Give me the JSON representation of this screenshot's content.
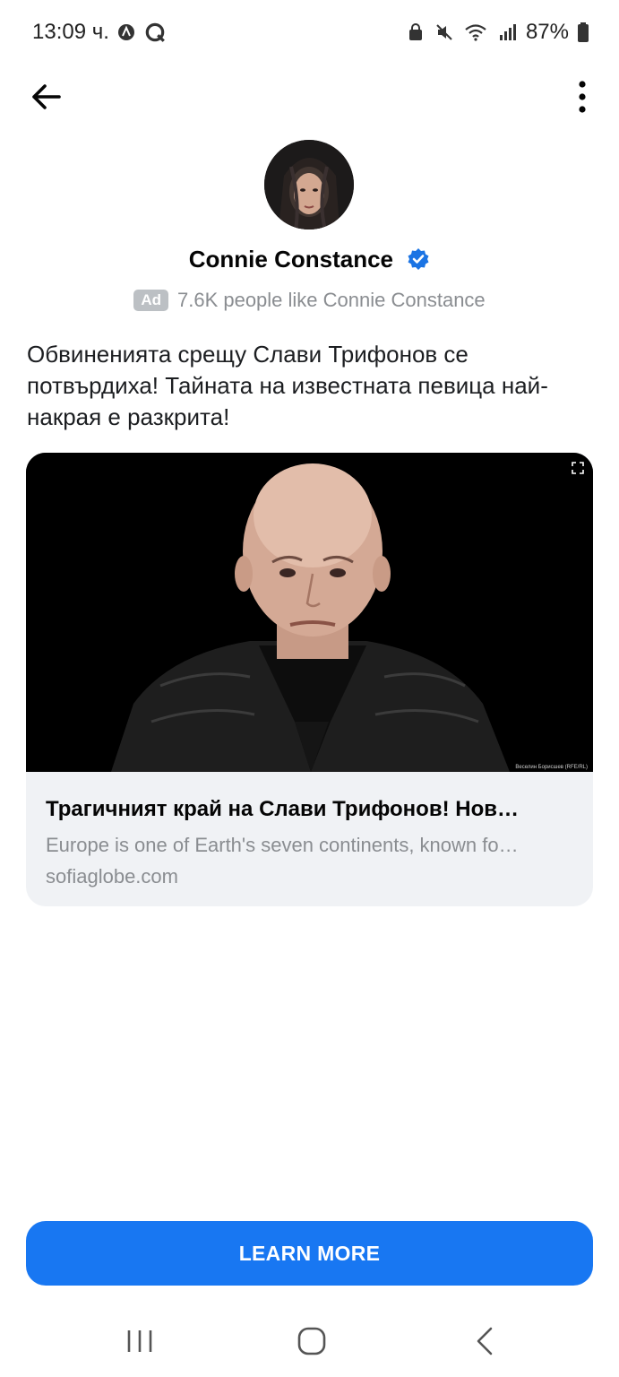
{
  "status_bar": {
    "time": "13:09 ч.",
    "battery": "87%",
    "icons_left": [
      "circle-a-icon",
      "q-icon"
    ],
    "icons_right": [
      "lock-icon",
      "mute-icon",
      "wifi-icon",
      "signal-icon",
      "battery-icon"
    ]
  },
  "header": {
    "back_icon": "arrow-left-icon",
    "more_icon": "more-vertical-icon"
  },
  "page": {
    "name": "Connie Constance",
    "ad_label": "Ad",
    "likes_text": "7.6K people like Connie Constance"
  },
  "post": {
    "text": "Обвиненията срещу Слави Трифонов се потвърдиха! Тайната на известната певица най-накрая е разкрита!"
  },
  "link_card": {
    "image_credit": "Веселин Борисшев (RFE/RL)",
    "title": "Трагичният край на Слави Трифонов! Нов…",
    "description": "Europe is one of Earth's seven continents, known fo…",
    "domain": "sofiaglobe.com"
  },
  "cta": {
    "label": "LEARN MORE"
  },
  "colors": {
    "brand_blue": "#1877f2",
    "verified_blue": "#1b74e4",
    "secondary_text": "#8a8d91",
    "card_bg": "#f0f2f5"
  }
}
